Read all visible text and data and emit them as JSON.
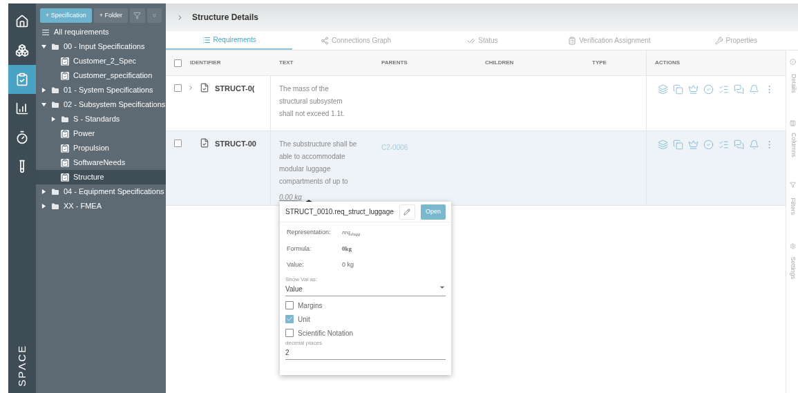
{
  "rail": {
    "items": [
      {
        "selected": false
      },
      {
        "selected": false
      },
      {
        "selected": true
      },
      {
        "selected": false
      },
      {
        "selected": false
      },
      {
        "selected": false
      }
    ],
    "logo": "SPΛCE"
  },
  "tree_toolbar": {
    "buttons": [
      {
        "label": "+ Specification",
        "kind": "primary"
      },
      {
        "label": "+ Folder",
        "kind": "secondary"
      },
      {
        "kind": "filter"
      },
      {
        "kind": "collapse"
      }
    ]
  },
  "tree": {
    "root": "All requirements",
    "items": [
      {
        "label": "00 - Input Specifications",
        "kind": "folder",
        "expanded": true,
        "selected": false,
        "children": [
          {
            "label": "Customer_2_Spec",
            "kind": "spec",
            "selected": false
          },
          {
            "label": "Customer_specification",
            "kind": "spec",
            "selected": false
          }
        ]
      },
      {
        "label": "01 - System Specifications",
        "kind": "folder",
        "expanded": false,
        "selected": false
      },
      {
        "label": "02 - Subsystem Specifications",
        "kind": "folder",
        "expanded": true,
        "selected": false,
        "children": [
          {
            "label": "S - Standards",
            "kind": "folder",
            "expanded": false,
            "selected": false
          },
          {
            "label": "Power",
            "kind": "spec",
            "selected": false
          },
          {
            "label": "Propulsion",
            "kind": "spec",
            "selected": false
          },
          {
            "label": "SoftwareNeeds",
            "kind": "spec",
            "selected": false
          },
          {
            "label": "Structure",
            "kind": "spec",
            "selected": true
          }
        ]
      },
      {
        "label": "04 - Equipment Specifications",
        "kind": "folder",
        "expanded": false,
        "selected": false
      },
      {
        "label": "XX - FMEA",
        "kind": "folder",
        "expanded": false,
        "selected": false
      }
    ]
  },
  "header": {
    "title": "Structure Details"
  },
  "tabs": [
    {
      "label": "Requirements",
      "selected": true
    },
    {
      "label": "Connections Graph",
      "selected": false
    },
    {
      "label": "Status",
      "selected": false
    },
    {
      "label": "Verification Assignment",
      "selected": false
    },
    {
      "label": "Properties",
      "selected": false
    }
  ],
  "table": {
    "select_all_checked": false,
    "columns": [
      "IDENTIFIER",
      "TEXT",
      "PARENTS",
      "CHILDREN",
      "TYPE",
      "ACTIONS"
    ],
    "rows": [
      {
        "identifier": "STRUCT-0(",
        "checked": false,
        "has_children": true,
        "text": "The mass of the structural subsystem shall not exceed 1.1t.",
        "selected": false
      },
      {
        "identifier": "STRUCT-00",
        "checked": false,
        "has_children": false,
        "text": "The substructure shall be able to accommodate modular luggage compartments of up to",
        "link": "0.00 kg",
        "parents": "C2-0006",
        "selected": true
      }
    ]
  },
  "popover": {
    "title": "STRUCT_0010.req_struct_luggage",
    "open_button": "Open",
    "fields": [
      {
        "label": "Representation:",
        "value": "req$_{slugg}$",
        "kind": "math"
      },
      {
        "label": "Formula:",
        "value": "0kg",
        "kind": "serif"
      },
      {
        "label": "Value:",
        "value": "0 kg",
        "kind": "plain"
      }
    ],
    "show_val_as": {
      "label": "Show Val as:",
      "value": "Value"
    },
    "options": [
      {
        "label": "Margins",
        "checked": false
      },
      {
        "label": "Unit",
        "checked": true
      },
      {
        "label": "Scientific Notation",
        "checked": false
      }
    ],
    "decimal_places": {
      "label": "decimal places",
      "value": "2"
    }
  },
  "side_tabs": [
    "Details",
    "Columns",
    "Filters",
    "Settings"
  ]
}
